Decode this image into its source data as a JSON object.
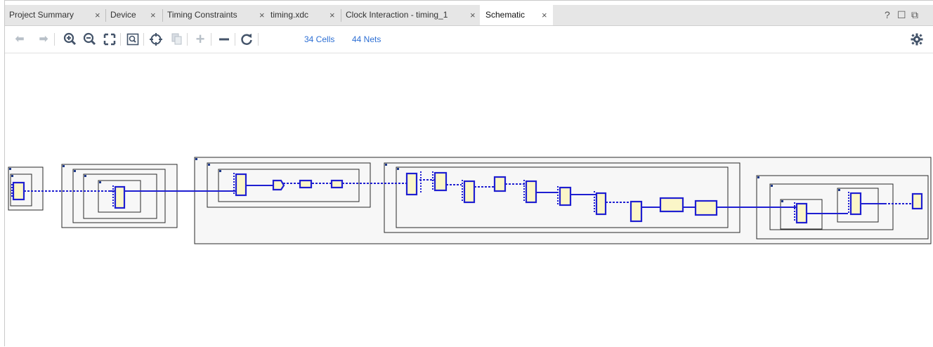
{
  "tabs": [
    {
      "label": "Project Summary",
      "close": "×"
    },
    {
      "label": "Device",
      "close": "×"
    },
    {
      "label": "Timing Constraints",
      "close": "×"
    },
    {
      "label": "timing.xdc",
      "close": "×"
    },
    {
      "label": "Clock Interaction - timing_1",
      "close": "×"
    },
    {
      "label": "Schematic",
      "close": "×"
    }
  ],
  "window_controls": {
    "help": "?",
    "restore": "☐",
    "float": "⧉"
  },
  "toolbar": {
    "buttons": [
      "back-arrow-icon",
      "forward-arrow-icon",
      "zoom-in-icon",
      "zoom-out-icon",
      "zoom-fit-icon",
      "zoom-area-icon",
      "select-center-icon",
      "copy-icon",
      "expand-plus-icon",
      "collapse-minus-icon",
      "refresh-icon"
    ],
    "cells_link": "34 Cells",
    "nets_link": "44 Nets",
    "settings_icon": "gear-icon"
  },
  "colors": {
    "wire": "#1f1fd1",
    "cell_fill": "#fbf6c8",
    "box_stroke": "#2a2a2a",
    "accent_link": "#2d6fd4"
  }
}
